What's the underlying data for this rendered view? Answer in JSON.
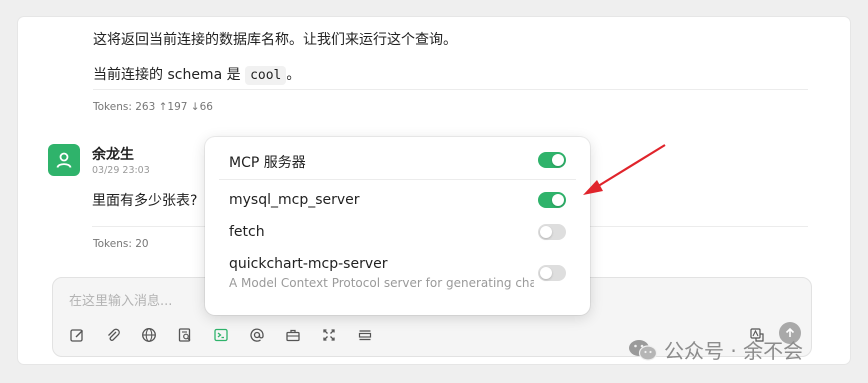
{
  "chat": {
    "assistant_line1": "这将返回当前连接的数据库名称。让我们来运行这个查询。",
    "assistant_line2_prefix": "当前连接的 schema 是",
    "assistant_line2_code": "cool",
    "assistant_line2_suffix": "。",
    "assistant_tokens": "Tokens: 263 ↑197 ↓66",
    "user_name": "余龙生",
    "user_time": "03/29 23:03",
    "user_message": "里面有多少张表?",
    "user_tokens": "Tokens: 20"
  },
  "input": {
    "placeholder": "在这里输入消息..."
  },
  "toolbar": {
    "icons": [
      "edit-icon",
      "attachment-icon",
      "globe-icon",
      "search-doc-icon",
      "terminal-icon",
      "mention-icon",
      "toolbox-icon",
      "expand-icon",
      "menu-icon",
      "translate-icon",
      "send-icon"
    ]
  },
  "mcp_popup": {
    "title": "MCP 服务器",
    "title_enabled": true,
    "servers": [
      {
        "name": "mysql_mcp_server",
        "enabled": true,
        "description": ""
      },
      {
        "name": "fetch",
        "enabled": false,
        "description": ""
      },
      {
        "name": "quickchart-mcp-server",
        "enabled": false,
        "description": "A Model Context Protocol server for generating cha..."
      }
    ]
  },
  "colors": {
    "accent": "#2fb36b",
    "annotation_arrow": "#e0242b"
  },
  "watermark": {
    "text": "公众号 · 余不会"
  }
}
